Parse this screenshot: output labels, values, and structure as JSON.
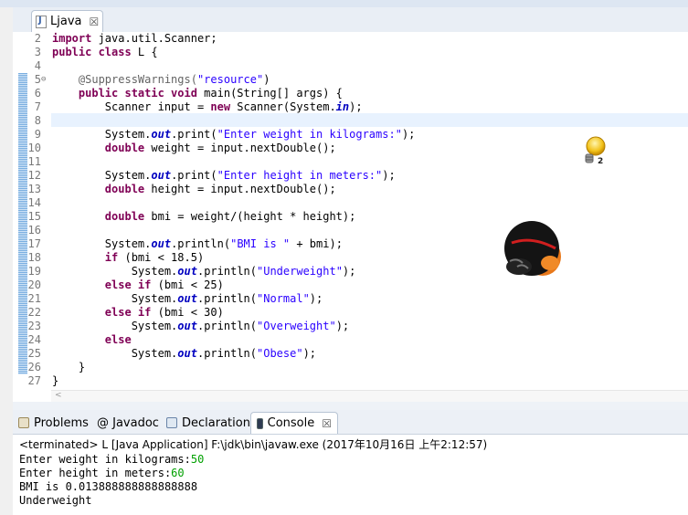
{
  "editor": {
    "tab_label": "Ljava",
    "tab_close": "☒",
    "lines": [
      {
        "n": "2",
        "fold": "",
        "tokens": [
          {
            "t": "import",
            "c": "kw"
          },
          {
            "t": " java.util.Scanner;",
            "c": ""
          }
        ]
      },
      {
        "n": "3",
        "fold": "",
        "tokens": [
          {
            "t": "public class",
            "c": "kw"
          },
          {
            "t": " L {",
            "c": ""
          }
        ]
      },
      {
        "n": "4",
        "fold": "",
        "tokens": []
      },
      {
        "n": "5",
        "fold": "⊖",
        "tokens": [
          {
            "t": "    @SuppressWarnings(",
            "c": "ann"
          },
          {
            "t": "\"resource\"",
            "c": "str"
          },
          {
            "t": ")",
            "c": ""
          }
        ]
      },
      {
        "n": "6",
        "fold": "",
        "tokens": [
          {
            "t": "    ",
            "c": ""
          },
          {
            "t": "public static void",
            "c": "kw"
          },
          {
            "t": " main(String[] args) {",
            "c": ""
          }
        ]
      },
      {
        "n": "7",
        "fold": "",
        "tokens": [
          {
            "t": "        Scanner input = ",
            "c": ""
          },
          {
            "t": "new",
            "c": "kw"
          },
          {
            "t": " Scanner(System.",
            "c": ""
          },
          {
            "t": "in",
            "c": "fld"
          },
          {
            "t": ");",
            "c": ""
          }
        ]
      },
      {
        "n": "8",
        "fold": "",
        "tokens": []
      },
      {
        "n": "9",
        "fold": "",
        "tokens": [
          {
            "t": "        System.",
            "c": ""
          },
          {
            "t": "out",
            "c": "fld"
          },
          {
            "t": ".print(",
            "c": ""
          },
          {
            "t": "\"Enter weight in kilograms:\"",
            "c": "str"
          },
          {
            "t": ");",
            "c": ""
          }
        ]
      },
      {
        "n": "10",
        "fold": "",
        "tokens": [
          {
            "t": "        ",
            "c": ""
          },
          {
            "t": "double",
            "c": "kw"
          },
          {
            "t": " weight = input.nextDouble();",
            "c": ""
          }
        ]
      },
      {
        "n": "11",
        "fold": "",
        "tokens": []
      },
      {
        "n": "12",
        "fold": "",
        "tokens": [
          {
            "t": "        System.",
            "c": ""
          },
          {
            "t": "out",
            "c": "fld"
          },
          {
            "t": ".print(",
            "c": ""
          },
          {
            "t": "\"Enter height in meters:\"",
            "c": "str"
          },
          {
            "t": ");",
            "c": ""
          }
        ]
      },
      {
        "n": "13",
        "fold": "",
        "tokens": [
          {
            "t": "        ",
            "c": ""
          },
          {
            "t": "double",
            "c": "kw"
          },
          {
            "t": " height = input.nextDouble();",
            "c": ""
          }
        ]
      },
      {
        "n": "14",
        "fold": "",
        "tokens": []
      },
      {
        "n": "15",
        "fold": "",
        "tokens": [
          {
            "t": "        ",
            "c": ""
          },
          {
            "t": "double",
            "c": "kw"
          },
          {
            "t": " bmi = weight/(height * height);",
            "c": ""
          }
        ]
      },
      {
        "n": "16",
        "fold": "",
        "tokens": []
      },
      {
        "n": "17",
        "fold": "",
        "tokens": [
          {
            "t": "        System.",
            "c": ""
          },
          {
            "t": "out",
            "c": "fld"
          },
          {
            "t": ".println(",
            "c": ""
          },
          {
            "t": "\"BMI is \"",
            "c": "str"
          },
          {
            "t": " + bmi);",
            "c": ""
          }
        ]
      },
      {
        "n": "18",
        "fold": "",
        "tokens": [
          {
            "t": "        ",
            "c": ""
          },
          {
            "t": "if",
            "c": "kw"
          },
          {
            "t": " (bmi < 18.5)",
            "c": ""
          }
        ]
      },
      {
        "n": "19",
        "fold": "",
        "tokens": [
          {
            "t": "            System.",
            "c": ""
          },
          {
            "t": "out",
            "c": "fld"
          },
          {
            "t": ".println(",
            "c": ""
          },
          {
            "t": "\"Underweight\"",
            "c": "str"
          },
          {
            "t": ");",
            "c": ""
          }
        ]
      },
      {
        "n": "20",
        "fold": "",
        "tokens": [
          {
            "t": "        ",
            "c": ""
          },
          {
            "t": "else if",
            "c": "kw"
          },
          {
            "t": " (bmi < 25)",
            "c": ""
          }
        ]
      },
      {
        "n": "21",
        "fold": "",
        "tokens": [
          {
            "t": "            System.",
            "c": ""
          },
          {
            "t": "out",
            "c": "fld"
          },
          {
            "t": ".println(",
            "c": ""
          },
          {
            "t": "\"Normal\"",
            "c": "str"
          },
          {
            "t": ");",
            "c": ""
          }
        ]
      },
      {
        "n": "22",
        "fold": "",
        "tokens": [
          {
            "t": "        ",
            "c": ""
          },
          {
            "t": "else if",
            "c": "kw"
          },
          {
            "t": " (bmi < 30)",
            "c": ""
          }
        ]
      },
      {
        "n": "23",
        "fold": "",
        "tokens": [
          {
            "t": "            System.",
            "c": ""
          },
          {
            "t": "out",
            "c": "fld"
          },
          {
            "t": ".println(",
            "c": ""
          },
          {
            "t": "\"Overweight\"",
            "c": "str"
          },
          {
            "t": ");",
            "c": ""
          }
        ]
      },
      {
        "n": "24",
        "fold": "",
        "tokens": [
          {
            "t": "        ",
            "c": ""
          },
          {
            "t": "else",
            "c": "kw"
          }
        ]
      },
      {
        "n": "25",
        "fold": "",
        "tokens": [
          {
            "t": "            System.",
            "c": ""
          },
          {
            "t": "out",
            "c": "fld"
          },
          {
            "t": ".println(",
            "c": ""
          },
          {
            "t": "\"Obese\"",
            "c": "str"
          },
          {
            "t": ");",
            "c": ""
          }
        ]
      },
      {
        "n": "26",
        "fold": "",
        "tokens": [
          {
            "t": "    }",
            "c": ""
          }
        ]
      },
      {
        "n": "27",
        "fold": "",
        "tokens": [
          {
            "t": "}",
            "c": ""
          }
        ]
      }
    ],
    "scroll_left": "<",
    "lightbulb_badge": "2"
  },
  "views": {
    "tabs": [
      {
        "label": "Problems",
        "icon": "problems-icon"
      },
      {
        "label": "@ Javadoc",
        "icon": "javadoc-icon"
      },
      {
        "label": "Declaration",
        "icon": "declaration-icon"
      },
      {
        "label": "Console",
        "icon": "console-icon",
        "active": true
      }
    ],
    "close_glyph": "☒"
  },
  "console": {
    "header": "<terminated> L [Java Application] F:\\jdk\\bin\\javaw.exe (2017年10月16日 上午2:12:57)",
    "lines": [
      [
        {
          "t": "Enter weight in kilograms:",
          "c": ""
        },
        {
          "t": "50",
          "c": "inp"
        }
      ],
      [
        {
          "t": "Enter height in meters:",
          "c": ""
        },
        {
          "t": "60",
          "c": "inp"
        }
      ],
      [
        {
          "t": "BMI is 0.013888888888888888",
          "c": ""
        }
      ],
      [
        {
          "t": "Underweight",
          "c": ""
        }
      ]
    ]
  },
  "colors": {
    "keyword": "#7f0055",
    "string": "#2a00ff",
    "field": "#0000c0",
    "console_input": "#00a000"
  }
}
